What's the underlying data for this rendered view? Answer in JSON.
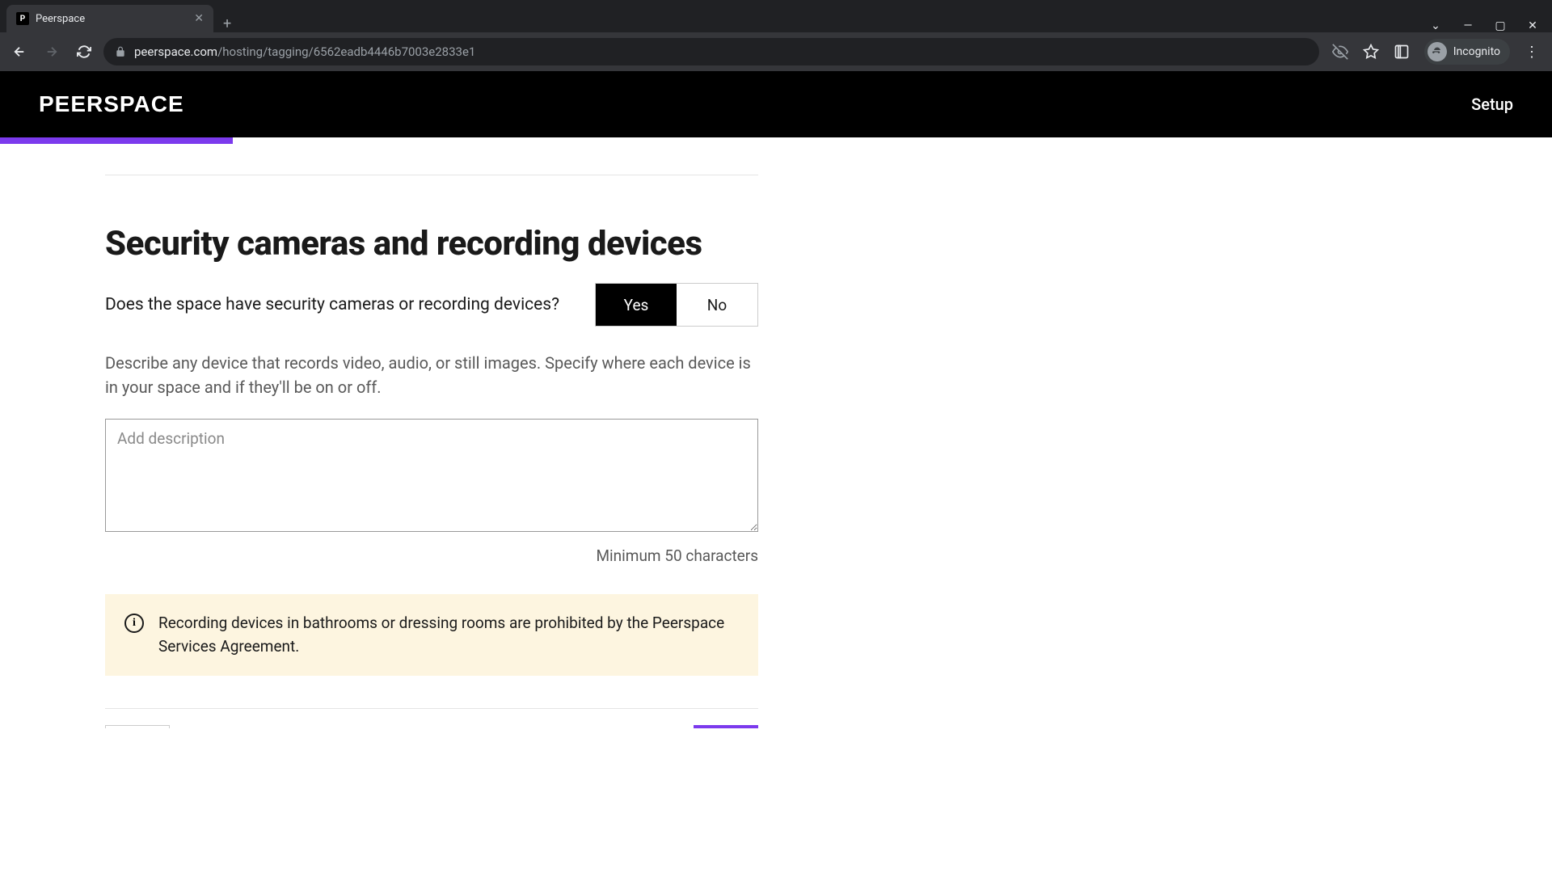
{
  "browser": {
    "tab_title": "Peerspace",
    "url_domain": "peerspace.com",
    "url_path": "/hosting/tagging/6562eadb4446b7003e2833e1",
    "incognito_label": "Incognito"
  },
  "header": {
    "logo": "PEERSPACE",
    "setup": "Setup"
  },
  "form": {
    "heading": "Security cameras and recording devices",
    "question": "Does the space have security cameras or recording devices?",
    "yes_label": "Yes",
    "no_label": "No",
    "selected": "yes",
    "instruction": "Describe any device that records video, audio, or still images. Specify where each device is in your space and if they'll be on or off.",
    "placeholder": "Add description",
    "value": "",
    "char_hint": "Minimum 50 characters",
    "notice": "Recording devices in bathrooms or dressing rooms are prohibited by the Peerspace Services Agreement."
  },
  "progress_percent": 15
}
